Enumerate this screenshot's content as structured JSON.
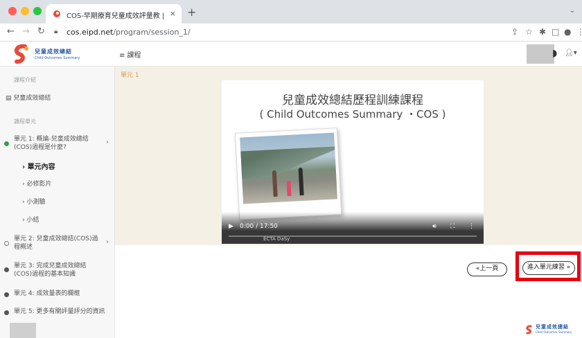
{
  "browser": {
    "tab_title": "COS-早期療育兒童成效評量教 |",
    "tab_close": "×",
    "new_tab": "+",
    "url_host": "cos.eipd.net",
    "url_path": "/program/session_1/"
  },
  "site": {
    "logo_text": "兒童成效總結",
    "logo_sub": "Child Outcomes Summary",
    "menu_label": "≡ 課程"
  },
  "sidebar": {
    "section_intro": "課程介紹",
    "intro_item": "兒童成效總結",
    "section_units": "課程單元",
    "units": [
      {
        "label": "單元 1: 概論-兒童成效總結(COS)過程是什麼?",
        "status": "active"
      },
      {
        "label": "單元內容",
        "status": "sub-bold"
      },
      {
        "label": "必修影片",
        "status": "sub"
      },
      {
        "label": "小測驗",
        "status": "sub"
      },
      {
        "label": "小結",
        "status": "sub"
      },
      {
        "label": "單元 2: 兒童成效總結(COS)過程概述",
        "status": "open"
      },
      {
        "label": "單元 3: 完成兒童成效總結(COS)過程的基本知識",
        "status": "done"
      },
      {
        "label": "單元 4: 成效量表的欄框",
        "status": "done"
      },
      {
        "label": "單元 5: 更多有關評量評分的資訊",
        "status": "done"
      }
    ]
  },
  "main": {
    "unit_label": "單元 1",
    "video_title_line1": "兒童成效總結歷程訓練課程",
    "video_title_line2": "( Child Outcomes Summary ・COS )",
    "video_time": "0:00 / 17:50",
    "sponsors": "ECTA  DaSy",
    "prev_button": "«上一頁",
    "next_button": "進入單元練習 »"
  },
  "footer": {
    "logo_text": "兒童成效總結",
    "logo_sub": "Child Outcomes Summary"
  },
  "colors": {
    "accent_orange": "#d4a24a",
    "highlight_red": "#e60012",
    "sidebar_active_green": "#3a9a4a",
    "brand_blue": "#2a5aa6"
  }
}
